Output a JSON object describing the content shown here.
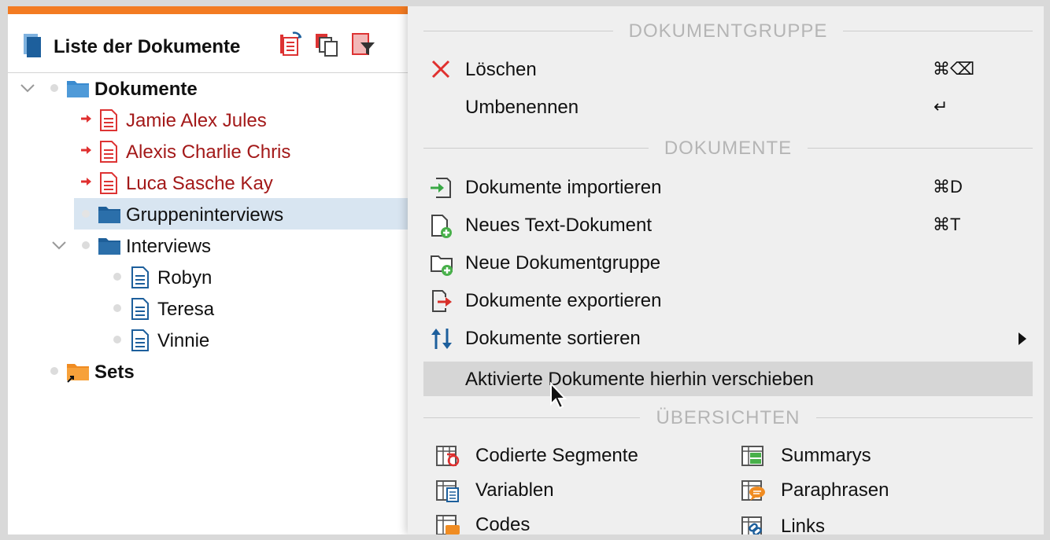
{
  "colors": {
    "accent_bar": "#f37b22",
    "selected_row": "#d8e5f1",
    "red_document": "#a31919",
    "folder_blue": "#3a8bd0",
    "folder_orange": "#f7a13a",
    "menu_bg": "#efefef",
    "menu_hover": "#d6d6d6"
  },
  "left_panel": {
    "title": "Liste der Dokumente",
    "header_icon": "document-list-icon",
    "toolbar": [
      {
        "name": "activate-documents-icon"
      },
      {
        "name": "copy-documents-icon"
      },
      {
        "name": "filter-documents-icon"
      }
    ],
    "tree": [
      {
        "label": "Dokumente",
        "style": "bold",
        "icon": "folder-blue-icon",
        "chevron": true,
        "level": 0
      },
      {
        "label": "Jamie Alex Jules",
        "style": "red",
        "icon": "red-document-icon",
        "activated": true,
        "level": 1
      },
      {
        "label": "Alexis Charlie Chris",
        "style": "red",
        "icon": "red-document-icon",
        "activated": true,
        "level": 1
      },
      {
        "label": "Luca Sasche Kay",
        "style": "red",
        "icon": "red-document-icon",
        "activated": true,
        "level": 1
      },
      {
        "label": "Gruppeninterviews",
        "style": "normal",
        "icon": "folder-blue-icon",
        "selected": true,
        "level": 1
      },
      {
        "label": "Interviews",
        "style": "normal",
        "icon": "folder-blue-icon",
        "chevron": true,
        "level": 1
      },
      {
        "label": "Robyn",
        "style": "normal",
        "icon": "text-document-icon",
        "level": 2
      },
      {
        "label": "Teresa",
        "style": "normal",
        "icon": "text-document-icon",
        "level": 2
      },
      {
        "label": "Vinnie",
        "style": "normal",
        "icon": "text-document-icon",
        "level": 2
      },
      {
        "label": "Sets",
        "style": "bold",
        "icon": "folder-orange-icon",
        "level": 0
      }
    ]
  },
  "menu": {
    "sections": {
      "group": "DOKUMENTGRUPPE",
      "documents": "DOKUMENTE",
      "overviews": "ÜBERSICHTEN"
    },
    "group_items": [
      {
        "label": "Löschen",
        "shortcut": "⌘⌫",
        "icon": "delete-icon"
      },
      {
        "label": "Umbenennen",
        "shortcut": "↵",
        "icon": ""
      }
    ],
    "document_items": [
      {
        "label": "Dokumente importieren",
        "shortcut": "⌘D",
        "icon": "import-icon"
      },
      {
        "label": "Neues Text-Dokument",
        "shortcut": "⌘T",
        "icon": "new-document-icon"
      },
      {
        "label": "Neue Dokumentgruppe",
        "shortcut": "",
        "icon": "new-group-icon"
      },
      {
        "label": "Dokumente exportieren",
        "shortcut": "",
        "icon": "export-icon"
      },
      {
        "label": "Dokumente sortieren",
        "shortcut": "",
        "icon": "sort-icon",
        "submenu": true
      },
      {
        "label": "Aktivierte Dokumente hierhin verschieben",
        "shortcut": "",
        "icon": "",
        "hovered": true
      }
    ],
    "overview_items": [
      {
        "label": "Codierte Segmente",
        "icon": "coded-segments-icon"
      },
      {
        "label": "Summarys",
        "icon": "summaries-icon"
      },
      {
        "label": "Variablen",
        "icon": "variables-icon"
      },
      {
        "label": "Paraphrasen",
        "icon": "paraphrases-icon"
      },
      {
        "label": "Codes",
        "icon": "codes-icon"
      },
      {
        "label": "Links",
        "icon": "links-icon"
      }
    ]
  }
}
